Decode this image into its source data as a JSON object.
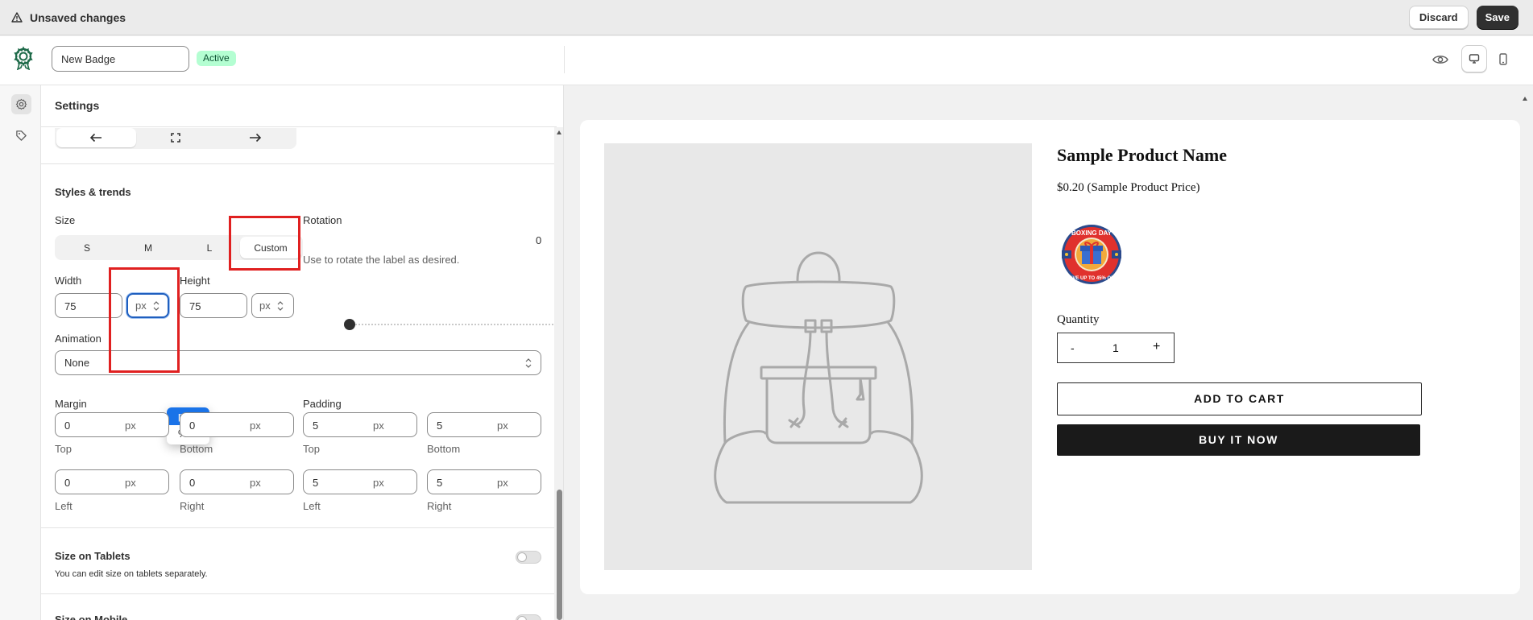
{
  "save_bar": {
    "message": "Unsaved changes",
    "discard_label": "Discard",
    "save_label": "Save"
  },
  "header": {
    "badge_name_value": "New Badge",
    "status": "Active",
    "preview_icon": "eye-icon",
    "desktop_icon": "desktop-icon",
    "mobile_icon": "mobile-icon",
    "selected_device": "desktop"
  },
  "rail": {
    "items": [
      {
        "icon": "gear-icon",
        "active": true
      },
      {
        "icon": "tag-icon",
        "active": false
      }
    ]
  },
  "settings": {
    "title": "Settings",
    "position_options": [
      {
        "icon": "arrow-left-icon",
        "active": true
      },
      {
        "icon": "fullscreen-icon",
        "active": false
      },
      {
        "icon": "arrow-right-icon",
        "active": false
      }
    ],
    "styles_heading": "Styles & trends",
    "size_label": "Size",
    "size_options": [
      "S",
      "M",
      "L",
      "Custom"
    ],
    "size_selected": "Custom",
    "rotation_label": "Rotation",
    "rotation_value": "0",
    "rotation_help": "Use to rotate the label as desired.",
    "width_label": "Width",
    "width_value": "75",
    "width_unit": "px",
    "height_label": "Height",
    "height_value": "75",
    "height_unit": "px",
    "unit_dropdown_options": [
      "px",
      "%"
    ],
    "unit_dropdown_selected": "px",
    "animation_label": "Animation",
    "animation_value": "None",
    "margin_label": "Margin",
    "padding_label": "Padding",
    "margin": {
      "top": {
        "value": "0",
        "unit": "px",
        "label": "Top"
      },
      "bottom": {
        "value": "0",
        "unit": "px",
        "label": "Bottom"
      },
      "left": {
        "value": "0",
        "unit": "px",
        "label": "Left"
      },
      "right": {
        "value": "0",
        "unit": "px",
        "label": "Right"
      }
    },
    "padding": {
      "top": {
        "value": "5",
        "unit": "px",
        "label": "Top"
      },
      "bottom": {
        "value": "5",
        "unit": "px",
        "label": "Bottom"
      },
      "left": {
        "value": "5",
        "unit": "px",
        "label": "Left"
      },
      "right": {
        "value": "5",
        "unit": "px",
        "label": "Right"
      }
    },
    "tablets_heading": "Size on Tablets",
    "tablets_help": "You can edit size on tablets separately.",
    "tablets_enabled": false,
    "mobile_heading": "Size on Mobile"
  },
  "preview": {
    "product_name": "Sample Product Name",
    "product_price": "$0.20 (Sample Product Price)",
    "badge_image": "boxing-day-sale-badge",
    "quantity_label": "Quantity",
    "qty_minus": "-",
    "qty_value": "1",
    "qty_plus": "+",
    "add_to_cart": "ADD TO CART",
    "buy_now": "BUY IT NOW"
  },
  "colors": {
    "active_badge_bg": "#b4fed2",
    "highlight_red": "#e02020",
    "dropdown_selected": "#1a73e8",
    "save_button": "#303030"
  }
}
